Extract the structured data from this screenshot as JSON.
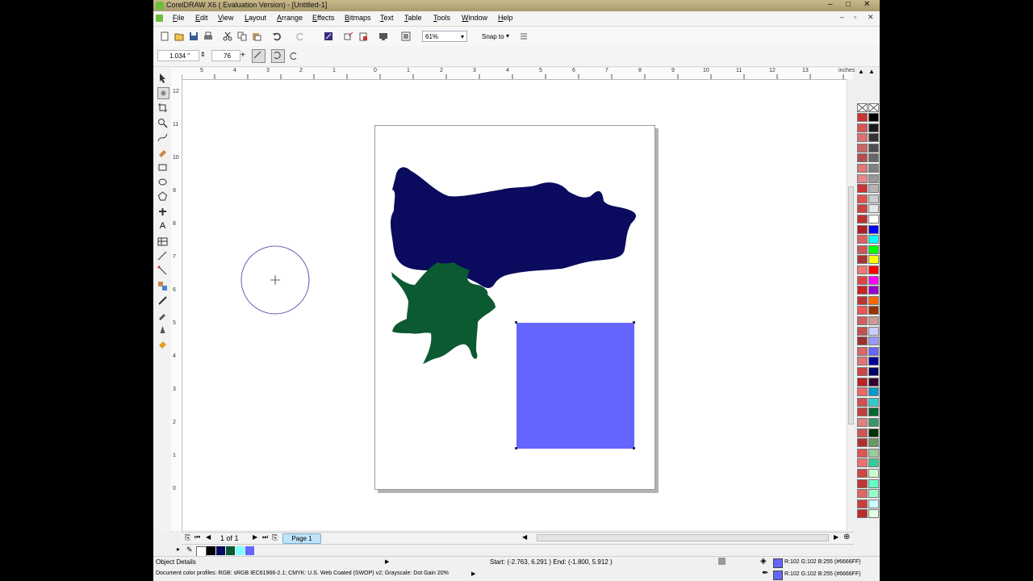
{
  "app": {
    "title": "CorelDRAW X6 ( Evaluation Version) - [Untitled-1]"
  },
  "menu": {
    "items": [
      "File",
      "Edit",
      "View",
      "Layout",
      "Arrange",
      "Effects",
      "Bitmaps",
      "Text",
      "Table",
      "Tools",
      "Window",
      "Help"
    ]
  },
  "toolbar": {
    "zoom": "61%",
    "snap_to": "Snap to"
  },
  "propbar": {
    "size_value": "1.034 \"",
    "nodes_value": "76"
  },
  "ruler": {
    "unit": "inches",
    "top_labels": [
      "5",
      "4",
      "3",
      "2",
      "1",
      "0",
      "1",
      "2",
      "3",
      "4",
      "5",
      "6",
      "7",
      "8",
      "9",
      "10",
      "11",
      "12",
      "13"
    ],
    "left_labels": [
      "12",
      "11",
      "10",
      "9",
      "8",
      "7",
      "6",
      "5",
      "4",
      "3",
      "2",
      "1",
      "0"
    ]
  },
  "pages": {
    "indicator": "1 of 1",
    "tab_label": "Page 1"
  },
  "document_palette": [
    "#000000",
    "#0a0a5e",
    "#0b5a31",
    "#7fffff",
    "#6666ff"
  ],
  "color_palette": [
    "#000000",
    "#1a1a1a",
    "#333333",
    "#4d4d4d",
    "#666666",
    "#808080",
    "#999999",
    "#b3b3b3",
    "#cccccc",
    "#e6e6e6",
    "#ffffff",
    "#0000ff",
    "#00ffff",
    "#00ff00",
    "#ffff00",
    "#ff0000",
    "#ff00ff",
    "#9900cc",
    "#ff6600",
    "#993300",
    "#cc9999",
    "#ccccff",
    "#9999ff",
    "#6666ff",
    "#000099",
    "#000066",
    "#330033",
    "#0099cc",
    "#33cccc",
    "#006633",
    "#339966",
    "#003300",
    "#669966",
    "#99cc99",
    "#33cc99",
    "#ccffcc",
    "#66ffcc",
    "#99ffcc",
    "#ccffff",
    "#e6ffe6"
  ],
  "palette_left_column": [
    "#cc3333",
    "#d95555",
    "#e07070",
    "#cc6666",
    "#b34d4d",
    "#dd7777",
    "#e88888",
    "#cc3333",
    "#e05050",
    "#d04040",
    "#c03030",
    "#b02020",
    "#e06060",
    "#cc5555",
    "#aa3333",
    "#ee7777",
    "#dd4444",
    "#cc2222",
    "#bb3333",
    "#ee5555",
    "#d06060",
    "#c55050",
    "#a03030",
    "#dd6666",
    "#e07575",
    "#cc4444",
    "#bb2222",
    "#ee6666",
    "#d05050",
    "#c04040",
    "#e08080",
    "#cc5555",
    "#b03030",
    "#dd5555",
    "#ee7070",
    "#d04545",
    "#c03535",
    "#e06565",
    "#cc3c3c",
    "#bb2b2b"
  ],
  "canvas": {
    "shapes": [
      {
        "name": "navy-blob",
        "fill": "#0a0a5e"
      },
      {
        "name": "green-star",
        "fill": "#0b5a31"
      },
      {
        "name": "blue-rectangle",
        "fill": "#6666ff"
      },
      {
        "name": "circle-outline",
        "stroke": "#3a3ab0"
      }
    ]
  },
  "status": {
    "object_details": "Object Details",
    "coords": "Start: (-2.763, 6.291 )  End: (-1.800, 5.912 )",
    "profiles": "Document color profiles: RGB: sRGB IEC61966-2.1; CMYK: U.S. Web Coated (SWOP) v2; Grayscale: Dot Gain 20%",
    "fill_info": "R:102 G:102 B:255 (#6666FF)",
    "outline_info": "R:102 G:102 B:255 (#6666FF)"
  }
}
